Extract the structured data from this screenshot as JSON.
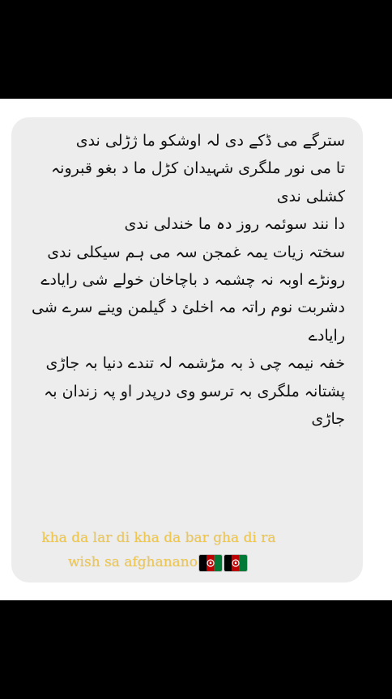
{
  "poem": {
    "lines": [
      "سترگے می ڈکے دی لہ اوشکو ما ژڑلی ندی",
      "تا می نور ملگری شہیدان کڑل ما د بغو قبرونہ کشلی ندی",
      "دا نند سوئمہ روز دہ ما خندلی ندی",
      "سختہ زیات یمہ غمجن سہ می ہم سیکلی ندی",
      "رونڑے اوبہ نہ چشمہ د باچاخان خولے شی رایادے",
      "دشربت نوم راتہ مہ اخلئ د گیلمن وینے سرے شی رایادے",
      "خفہ نیمہ چی ذ بہ مڑشمہ لہ تندے دنیا بہ جاڑی",
      "پشتانہ ملگری بہ ترسو وی درپدر او پہ زندان بہ جاڑی"
    ]
  },
  "caption": {
    "text": "kha da lar di kha da bar gha di ra wish sa afghanano",
    "flag_icon_name": "afghanistan-flag-icon",
    "flag_count": 2,
    "color": "#f1c74a"
  },
  "colors": {
    "background": "#000000",
    "panel": "#ffffff",
    "bubble": "#ededed",
    "text": "#111111"
  }
}
